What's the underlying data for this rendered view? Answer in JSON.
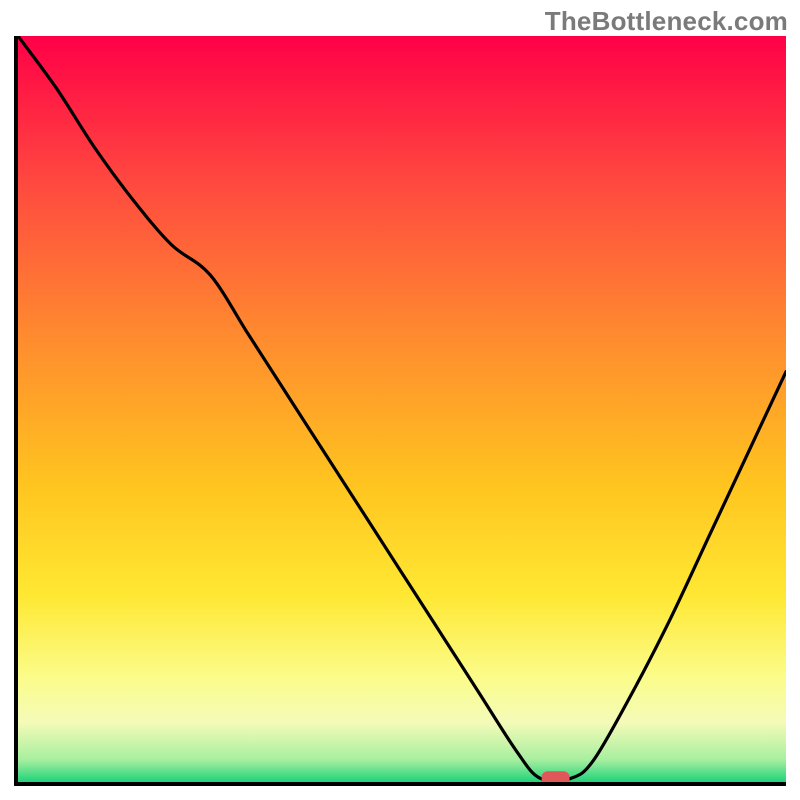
{
  "watermark": "TheBottleneck.com",
  "chart_data": {
    "type": "line",
    "title": "",
    "xlabel": "",
    "ylabel": "",
    "xlim": [
      0,
      100
    ],
    "ylim": [
      0,
      100
    ],
    "x": [
      0,
      5,
      10,
      15,
      20,
      25,
      30,
      35,
      40,
      45,
      50,
      55,
      60,
      65,
      68,
      72,
      75,
      80,
      85,
      90,
      95,
      100
    ],
    "values": [
      100,
      93,
      85,
      78,
      72,
      68,
      60,
      52,
      44,
      36,
      28,
      20,
      12,
      4,
      0.5,
      0.5,
      3,
      12,
      22,
      33,
      44,
      55
    ],
    "marker": {
      "x": 70,
      "y": 0.5
    },
    "gradient_stops": [
      {
        "offset": 0,
        "color": "#ff0047"
      },
      {
        "offset": 20,
        "color": "#ff4a3f"
      },
      {
        "offset": 40,
        "color": "#ff8a2f"
      },
      {
        "offset": 60,
        "color": "#ffc41f"
      },
      {
        "offset": 75,
        "color": "#ffe833"
      },
      {
        "offset": 86,
        "color": "#fbfc8a"
      },
      {
        "offset": 92,
        "color": "#f4fbb8"
      },
      {
        "offset": 97,
        "color": "#a8ef9f"
      },
      {
        "offset": 100,
        "color": "#1fd37a"
      }
    ]
  }
}
